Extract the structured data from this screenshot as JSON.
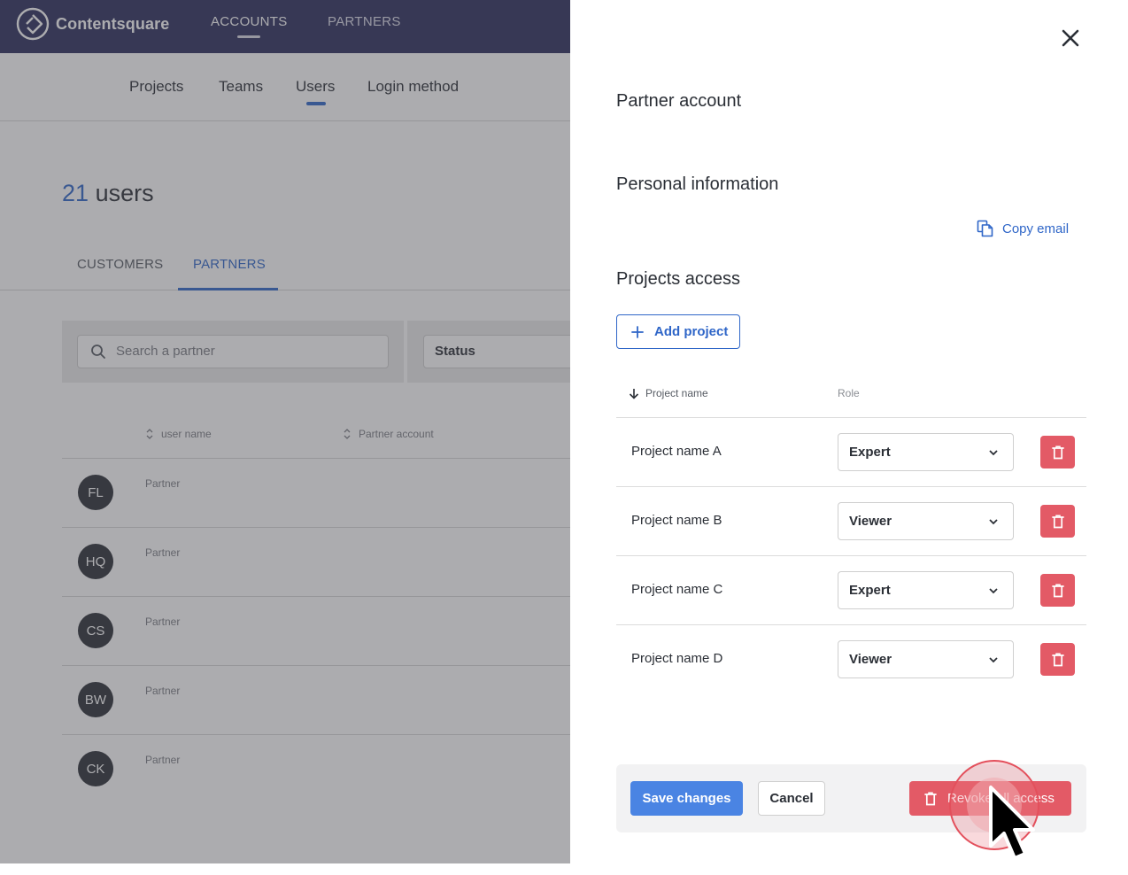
{
  "colors": {
    "brand_nav": "#2b2d5c",
    "accent_blue": "#2f66c8",
    "primary_button": "#4a84e3",
    "danger": "#e35a66"
  },
  "app": {
    "logo_text": "Contentsquare",
    "topnav": {
      "accounts": "ACCOUNTS",
      "partners": "PARTNERS"
    },
    "subnav": {
      "projects": "Projects",
      "teams": "Teams",
      "users": "Users",
      "login_method": "Login method"
    },
    "users_count": {
      "number": "21",
      "label": "users"
    },
    "tabs": {
      "customers": "CUSTOMERS",
      "partners": "PARTNERS"
    },
    "search": {
      "placeholder": "Search a partner"
    },
    "status_filter": "Status",
    "columns": {
      "user_name": "user name",
      "partner_account": "Partner account"
    },
    "rows": [
      {
        "initials": "FL",
        "label": "Partner"
      },
      {
        "initials": "HQ",
        "label": "Partner"
      },
      {
        "initials": "CS",
        "label": "Partner"
      },
      {
        "initials": "BW",
        "label": "Partner"
      },
      {
        "initials": "CK",
        "label": "Partner"
      }
    ]
  },
  "drawer": {
    "partner_account_title": "Partner account",
    "personal_info_title": "Personal information",
    "copy_email": "Copy email",
    "projects_access_title": "Projects access",
    "add_project": "Add project",
    "table_headers": {
      "project_name": "Project name",
      "role": "Role"
    },
    "projects": [
      {
        "name": "Project name A",
        "role": "Expert"
      },
      {
        "name": "Project name B",
        "role": "Viewer"
      },
      {
        "name": "Project name C",
        "role": "Expert"
      },
      {
        "name": "Project name D",
        "role": "Viewer"
      }
    ],
    "footer": {
      "save": "Save changes",
      "cancel": "Cancel",
      "revoke": "Revoke all access"
    }
  }
}
